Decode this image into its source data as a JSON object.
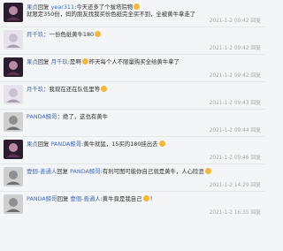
{
  "comments": [
    {
      "author": "果贞",
      "avatar_style": "dark",
      "reply_prefix": "回复 ",
      "reply_to": "year311",
      "text_a": ":今天还多了个拔塔院物",
      "text_b": "就限定350份，妈的朋友找我买份色纸完全买不到，全被黄牛拿走了",
      "timestamp": "2021-1-2 09:42 回复"
    },
    {
      "author": "月千玖",
      "avatar_style": "light",
      "text_a": "：一份色纸黄牛180",
      "text_b": "",
      "timestamp": "2021-1-2 09:42 回复"
    },
    {
      "author": "果贞",
      "avatar_style": "dark",
      "reply_prefix": "回复 ",
      "reply_to": "月千玖",
      "text_a": ":是啊",
      "text_b": "昨天每个人不限量购买全给黄牛拿了",
      "timestamp": "2021-1-2 09:42 回复"
    },
    {
      "author": "月千玖",
      "avatar_style": "light",
      "text_a": "：我现在还在队伍里等",
      "text_b": "",
      "timestamp": "2021-1-2 09:43 回复"
    },
    {
      "author": "PANDA鲸哥",
      "avatar_style": "gray",
      "text_a": "：绝了，这也有黄牛",
      "text_b": "",
      "timestamp": "2021-1-2 09:44 回复"
    },
    {
      "author": "果贞",
      "avatar_style": "dark",
      "reply_prefix": "回复 ",
      "reply_to": "PANDA鲸哥",
      "text_a": ":黄牛就猛，15买的180挂出去",
      "text_b": "",
      "timestamp": "2021-1-2 09:46 回复"
    },
    {
      "author": "壹個-善通人",
      "avatar_style": "gray",
      "reply_prefix": "回复 ",
      "reply_to": "PANDA鲸哥",
      "text_a": ":有利可图可能你自己就是黄牛，人心险恶",
      "text_b": "",
      "timestamp": "2021-1-2 14:29 回复"
    },
    {
      "author": "PANDA鲸哥",
      "avatar_style": "gray",
      "reply_prefix": "回复 ",
      "reply_to": "壹個-善通人",
      "text_a": ":黄牛竟是我自己",
      "text_b": "！",
      "timestamp": "2021-1-2 16:35 回复"
    }
  ],
  "colors": {
    "name_blue": "#3f6bb3",
    "timestamp_gray": "#a8a8ad",
    "background": "#f4f5f7",
    "divider": "#e6e7ea"
  }
}
